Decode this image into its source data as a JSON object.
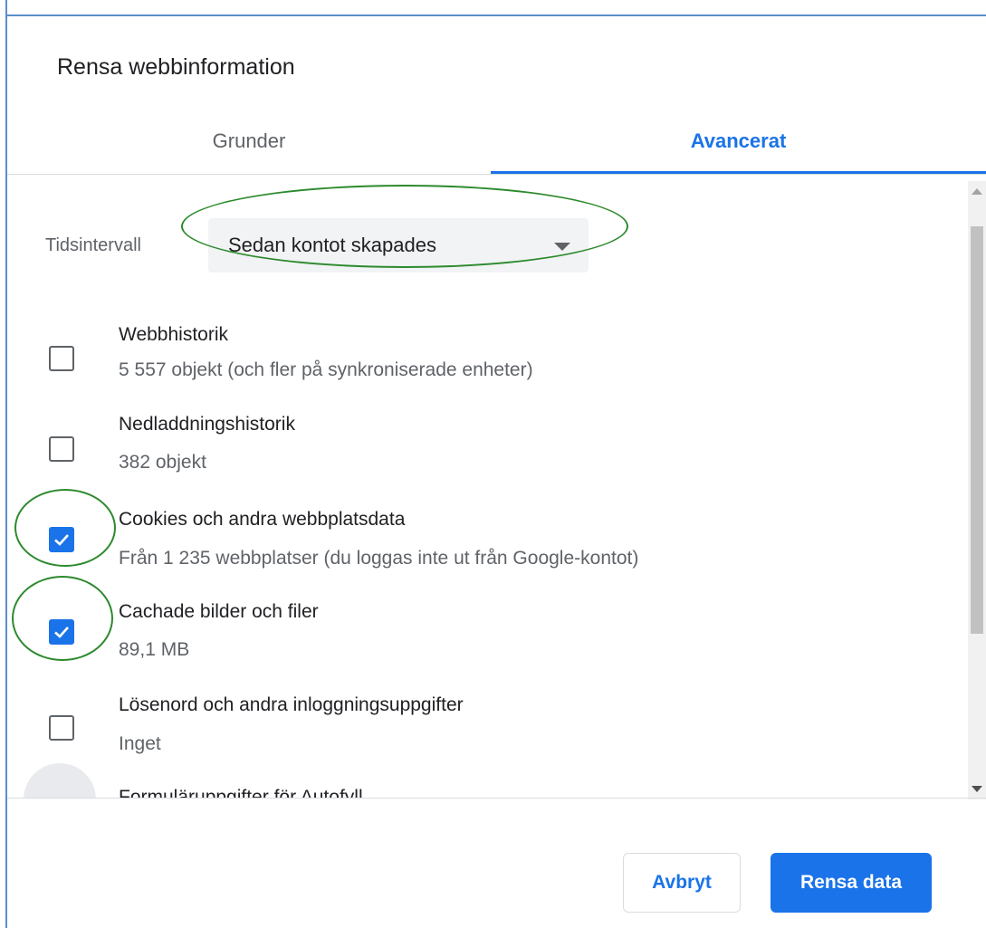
{
  "dialog": {
    "title": "Rensa webbinformation"
  },
  "tabs": [
    {
      "label": "Grunder",
      "active": false
    },
    {
      "label": "Avancerat",
      "active": true
    }
  ],
  "time_range": {
    "label": "Tidsintervall",
    "selected": "Sedan kontot skapades"
  },
  "items": [
    {
      "title": "Webbhistorik",
      "subtitle": "5 557 objekt (och fler på synkroniserade enheter)",
      "checked": false
    },
    {
      "title": "Nedladdningshistorik",
      "subtitle": "382 objekt",
      "checked": false
    },
    {
      "title": "Cookies och andra webbplatsdata",
      "subtitle": "Från 1 235 webbplatser (du loggas inte ut från Google-kontot)",
      "checked": true
    },
    {
      "title": "Cachade bilder och filer",
      "subtitle": "89,1 MB",
      "checked": true
    },
    {
      "title": "Lösenord och andra inloggningsuppgifter",
      "subtitle": "Inget",
      "checked": false
    },
    {
      "title": "Formuläruppgifter för Autofyll",
      "subtitle": "",
      "checked": false
    }
  ],
  "buttons": {
    "cancel": "Avbryt",
    "clear": "Rensa data"
  },
  "colors": {
    "accent": "#1a73e8",
    "annotation": "#2d8a2d"
  }
}
